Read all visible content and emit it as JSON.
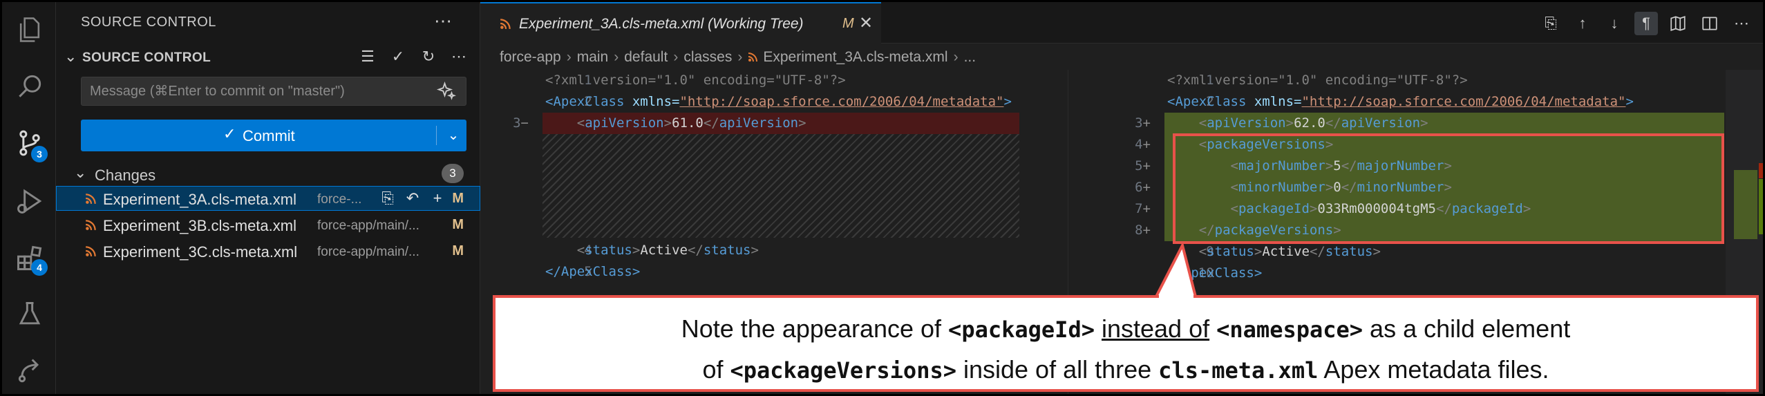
{
  "sidebar": {
    "title": "SOURCE CONTROL",
    "section_label": "SOURCE CONTROL",
    "message_placeholder": "Message (⌘Enter to commit on \"master\")",
    "commit_label": "Commit",
    "changes_label": "Changes",
    "changes_count": "3",
    "files": [
      {
        "name": "Experiment_3A.cls-meta.xml",
        "path": "force-...",
        "status": "M"
      },
      {
        "name": "Experiment_3B.cls-meta.xml",
        "path": "force-app/main/...",
        "status": "M"
      },
      {
        "name": "Experiment_3C.cls-meta.xml",
        "path": "force-app/main/...",
        "status": "M"
      }
    ]
  },
  "activity": {
    "scm_badge": "3",
    "ext_badge": "4"
  },
  "editor": {
    "tab_title": "Experiment_3A.cls-meta.xml (Working Tree)",
    "tab_status": "M",
    "breadcrumb": [
      "force-app",
      "main",
      "default",
      "classes",
      "Experiment_3A.cls-meta.xml",
      "..."
    ]
  },
  "left_pane": {
    "line_numbers": [
      "1",
      "2",
      "3",
      "4",
      "5"
    ],
    "removed_marker": "−",
    "xml_decl": "<?xml version=\"1.0\" encoding=\"UTF-8\"?>",
    "apexclass_open_tag": "<ApexClass",
    "xmlns_attr": "xmlns=",
    "xmlns_value": "\"http://soap.sforce.com/2006/04/metadata\"",
    "api_version_value": "61.0",
    "status_value": "Active",
    "apexclass_close": "</ApexClass>"
  },
  "right_pane": {
    "line_numbers": [
      "1",
      "2",
      "3",
      "4",
      "5",
      "6",
      "7",
      "8",
      "9",
      "10"
    ],
    "added_marker": "+",
    "xml_decl": "<?xml version=\"1.0\" encoding=\"UTF-8\"?>",
    "apexclass_open_tag": "<ApexClass",
    "xmlns_attr": "xmlns=",
    "xmlns_value": "\"http://soap.sforce.com/2006/04/metadata\"",
    "api_version_value": "62.0",
    "major_number": "5",
    "minor_number": "0",
    "package_id": "033Rm000004tgM5",
    "status_value": "Active",
    "apexclass_close": "</ApexClass>"
  },
  "tags": {
    "apiVersion": "apiVersion",
    "packageVersions": "packageVersions",
    "majorNumber": "majorNumber",
    "minorNumber": "minorNumber",
    "packageId": "packageId",
    "status": "status"
  },
  "callout": {
    "l1_a": "Note the appearance of ",
    "l1_code1": "<packageId>",
    "l1_b": " ",
    "l1_u": "instead of",
    "l1_c": " ",
    "l1_code2": "<namespace>",
    "l1_d": " as a child element",
    "l2_a": "of ",
    "l2_code1": "<packageVersions>",
    "l2_b": " inside of all three ",
    "l2_code2": "cls-meta.xml",
    "l2_c": " Apex metadata files."
  },
  "colors": {
    "accent": "#0078d4",
    "annotation_red": "#e8524a",
    "added_bg": "#4b5d25",
    "removed_bg": "#4b1818",
    "modified_status": "#e2c08d"
  }
}
